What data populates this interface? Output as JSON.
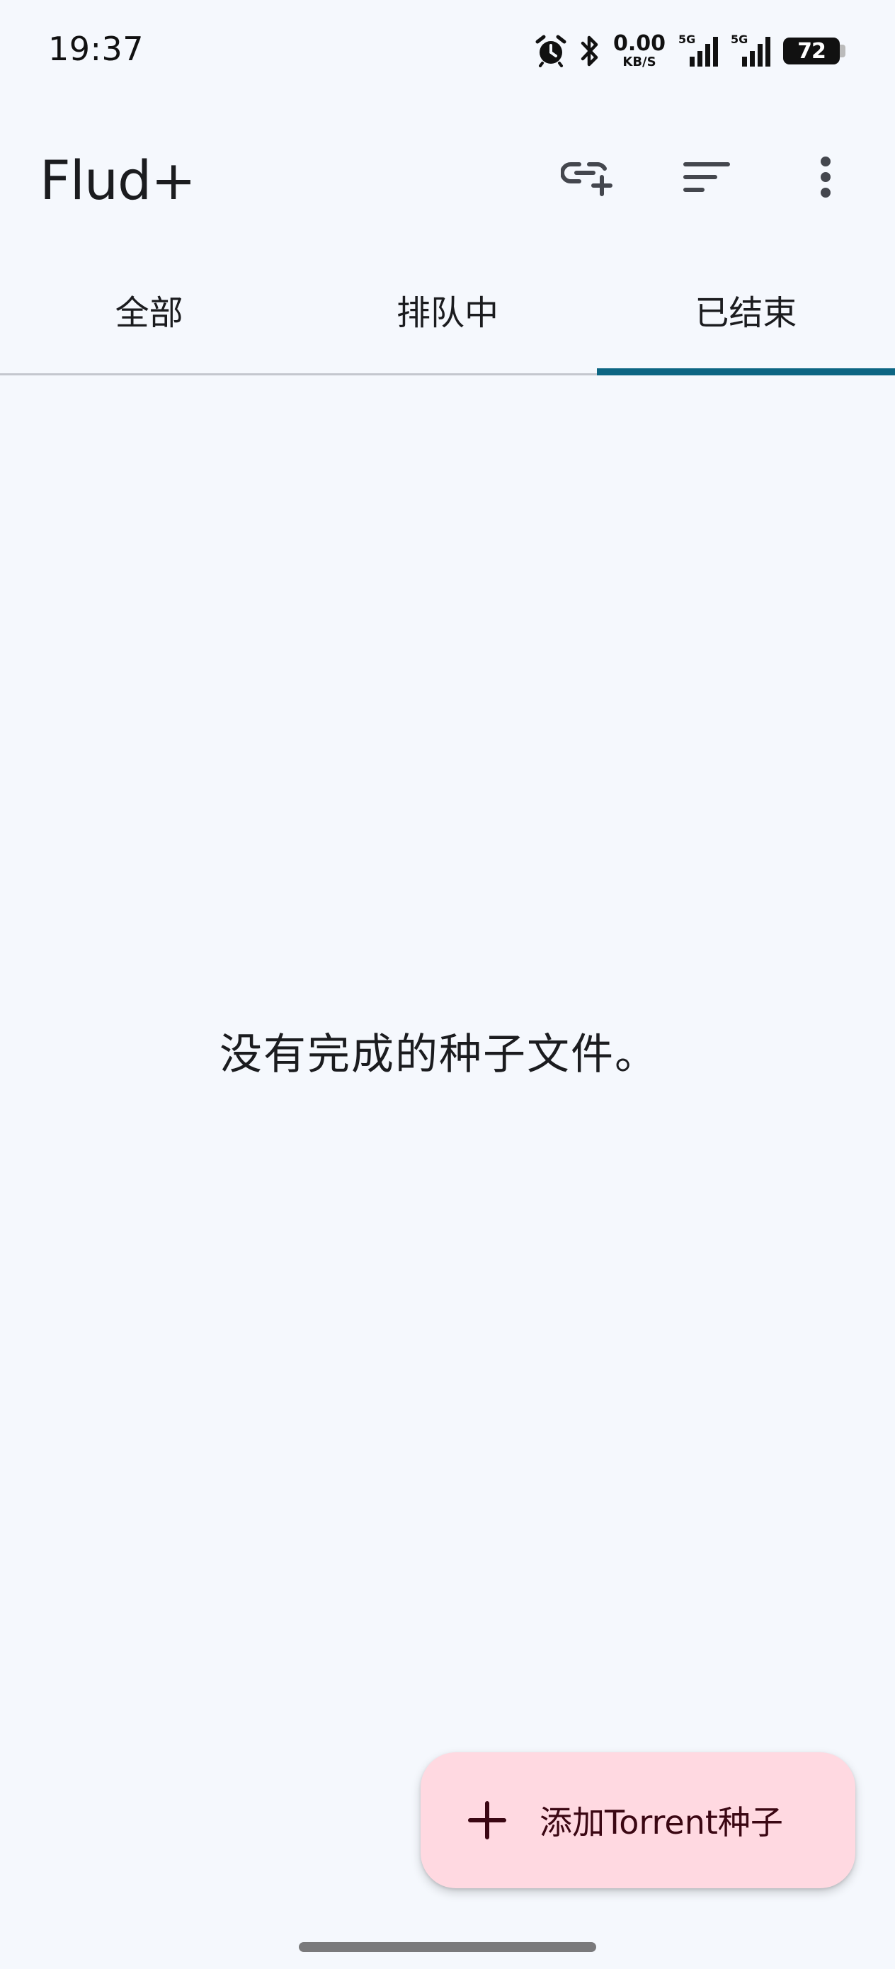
{
  "status_bar": {
    "time": "19:37",
    "net_speed_value": "0.00",
    "net_speed_unit": "KB/S",
    "signal_1_label": "5G",
    "signal_2_label": "5G",
    "battery_level": "72",
    "icons": [
      "alarm-icon",
      "bluetooth-icon",
      "signal-icon",
      "signal-icon",
      "battery-icon"
    ]
  },
  "app_bar": {
    "title": "Flud+",
    "actions": [
      "add-link-icon",
      "sort-icon",
      "more-vert-icon"
    ]
  },
  "tabs": [
    {
      "label": "全部",
      "active": false
    },
    {
      "label": "排队中",
      "active": false
    },
    {
      "label": "已结束",
      "active": true
    }
  ],
  "main": {
    "empty_message": "没有完成的种子文件。"
  },
  "fab": {
    "label": "添加Torrent种子",
    "icon": "plus-icon"
  },
  "colors": {
    "background": "#f5f8fd",
    "tab_indicator": "#0d6683",
    "fab_background": "#ffd9e1",
    "fab_foreground": "#3b0713"
  }
}
